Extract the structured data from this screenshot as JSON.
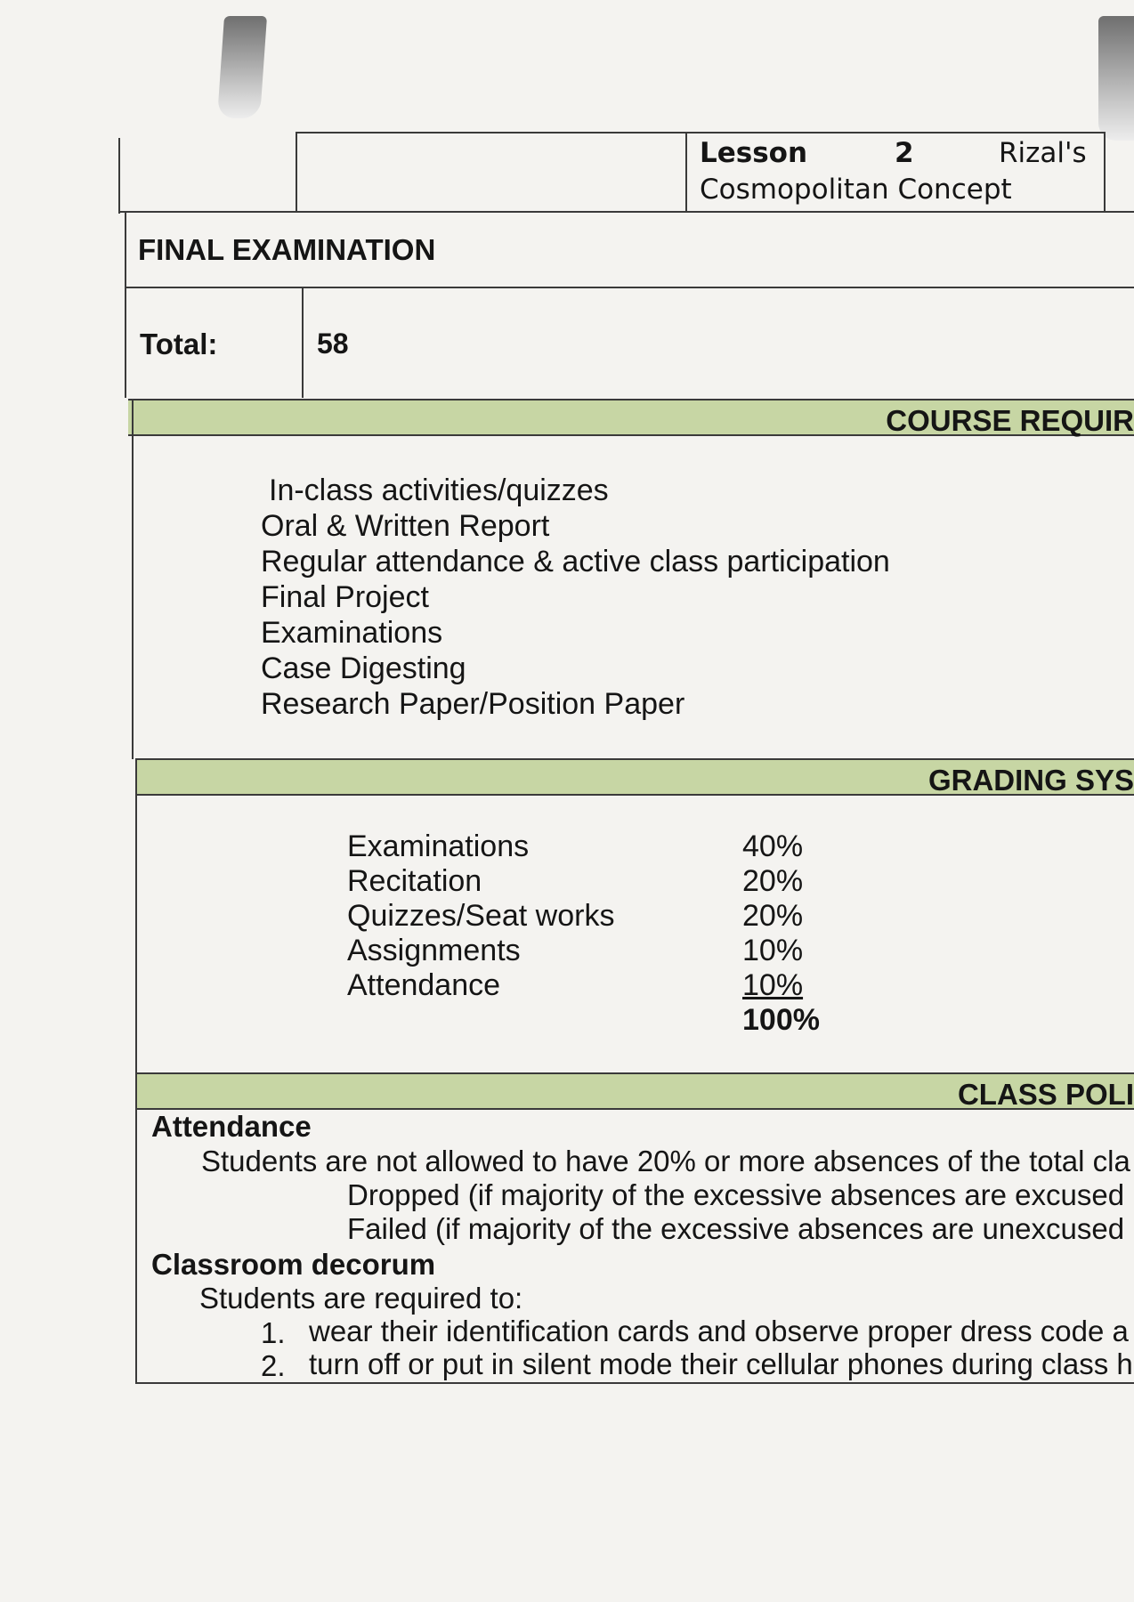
{
  "header": {
    "lesson_label": "Lesson",
    "lesson_number": "2",
    "lesson_title_part1": "Rizal's",
    "lesson_title_part2": "Cosmopolitan Concept"
  },
  "exam": {
    "title": "FINAL EXAMINATION",
    "total_label": "Total:",
    "total_value": "58"
  },
  "course_requirements": {
    "heading": "COURSE REQUIR",
    "items": [
      "In-class activities/quizzes",
      "Oral & Written Report",
      "Regular attendance & active class participation",
      "Final Project",
      "Examinations",
      "Case Digesting",
      "Research Paper/Position Paper"
    ]
  },
  "grading_system": {
    "heading": "GRADING SYS",
    "rows": [
      {
        "label": "Examinations",
        "value": "40%"
      },
      {
        "label": "Recitation",
        "value": "20%"
      },
      {
        "label": "Quizzes/Seat works",
        "value": "20%"
      },
      {
        "label": "Assignments",
        "value": "10%"
      },
      {
        "label": "Attendance",
        "value": "10%"
      }
    ],
    "total": "100%"
  },
  "class_policies": {
    "heading": "CLASS POLI",
    "attendance_heading": "Attendance",
    "attendance_text": "Students are not allowed to have 20% or more absences of the total cla",
    "dropped_text": "Dropped (if majority of the excessive absences are excused",
    "failed_text": "Failed (if majority of the excessive absences are unexcused",
    "decorum_heading": "Classroom decorum",
    "decorum_intro": "Students are required to:",
    "decorum_items": [
      {
        "num": "1.",
        "text": "wear their identification cards and observe proper dress code a"
      },
      {
        "num": "2.",
        "text": "turn off or put in silent mode their cellular phones during class h"
      }
    ]
  }
}
